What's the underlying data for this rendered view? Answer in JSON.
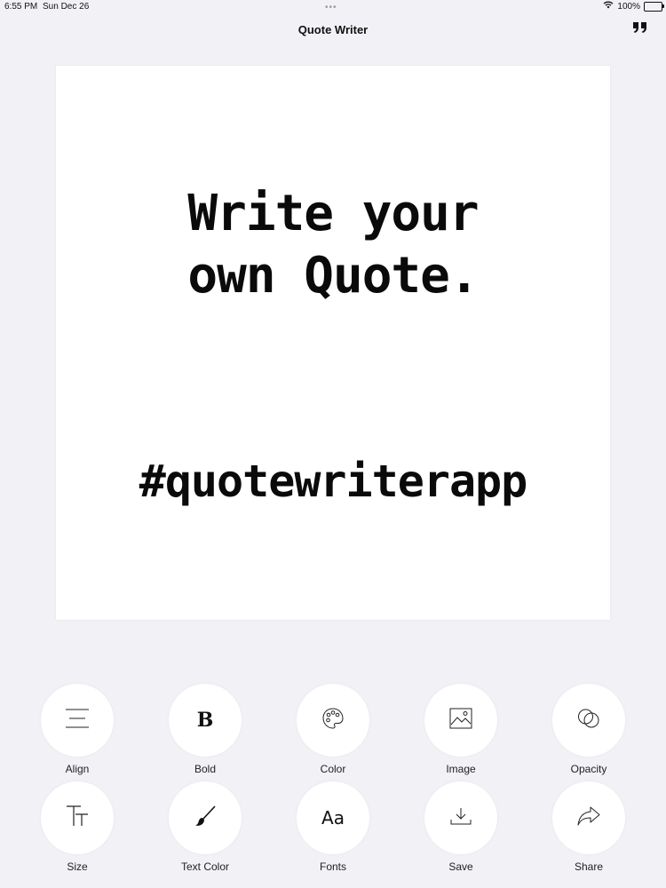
{
  "status_bar": {
    "time": "6:55 PM",
    "date": "Sun Dec 26",
    "battery": "100%",
    "battery_level": 1.0
  },
  "nav": {
    "title": "Quote Writer",
    "quote_icon": "quotation-mark-icon"
  },
  "canvas": {
    "quote": "Write your\nown Quote.",
    "hashtag": "#quotewriterapp",
    "background": "#ffffff",
    "text_color": "#0a0a0a"
  },
  "toolbar": {
    "tools": [
      {
        "label": "Align",
        "icon": "align-lines-icon"
      },
      {
        "label": "Bold",
        "icon": "bold-b-icon"
      },
      {
        "label": "Color",
        "icon": "palette-icon"
      },
      {
        "label": "Image",
        "icon": "image-icon"
      },
      {
        "label": "Opacity",
        "icon": "overlapping-circles-icon"
      },
      {
        "label": "Size",
        "icon": "text-size-icon"
      },
      {
        "label": "Text Color",
        "icon": "brush-icon"
      },
      {
        "label": "Fonts",
        "icon": "fonts-aa-icon",
        "glyph": "Aa"
      },
      {
        "label": "Save",
        "icon": "download-icon"
      },
      {
        "label": "Share",
        "icon": "share-arrow-icon"
      }
    ],
    "bold_glyph": "B"
  },
  "colors": {
    "background": "#f2f1f6",
    "button": "#ffffff",
    "icon": "#111111"
  }
}
